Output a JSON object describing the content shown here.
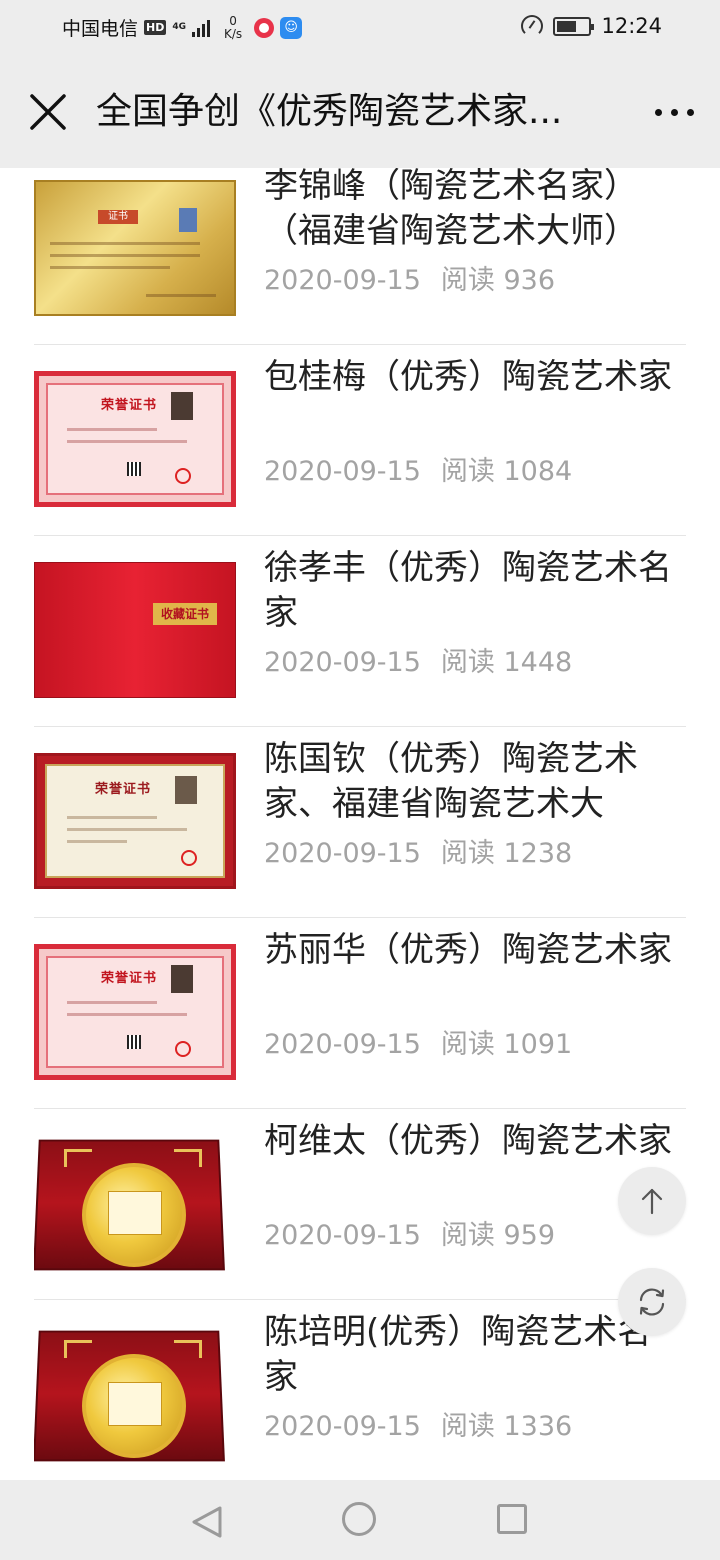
{
  "status_bar": {
    "carrier": "中国电信",
    "hd_label": "HD",
    "network_type": "4G",
    "speed_value": "0",
    "speed_unit": "K/s",
    "time": "12:24"
  },
  "nav": {
    "title": "全国争创《优秀陶瓷艺术家...",
    "close_icon": "close-icon",
    "more_icon": "more-dots-icon"
  },
  "views_label": "阅读",
  "articles": [
    {
      "title": "李锦峰（陶瓷艺术名家）（福建省陶瓷艺术大师）",
      "date": "2020-09-15",
      "views": "阅读 936",
      "thumb": "gold-certificate"
    },
    {
      "title": "包桂梅（优秀）陶瓷艺术家",
      "date": "2020-09-15",
      "views": "阅读 1084",
      "thumb": "pink-honor-certificate",
      "cert_text": "荣誉证书"
    },
    {
      "title": "徐孝丰（优秀）陶瓷艺术名家",
      "date": "2020-09-15",
      "views": "阅读 1448",
      "thumb": "red-certificate-cover",
      "cert_text": "收藏证书"
    },
    {
      "title": "陈国钦（优秀）陶瓷艺术家、福建省陶瓷艺术大",
      "date": "2020-09-15",
      "views": "阅读 1238",
      "thumb": "cream-honor-certificate",
      "cert_text": "荣誉证书"
    },
    {
      "title": "苏丽华（优秀）陶瓷艺术家",
      "date": "2020-09-15",
      "views": "阅读 1091",
      "thumb": "pink-honor-certificate",
      "cert_text": "荣誉证书"
    },
    {
      "title": "柯维太（优秀）陶瓷艺术家",
      "date": "2020-09-15",
      "views": "阅读 959",
      "thumb": "gold-plaque"
    },
    {
      "title": "陈培明(优秀）陶瓷艺术名家",
      "date": "2020-09-15",
      "views": "阅读 1336",
      "thumb": "gold-plaque"
    }
  ],
  "floating": {
    "top_icon": "arrow-up-icon",
    "refresh_icon": "refresh-icon"
  }
}
